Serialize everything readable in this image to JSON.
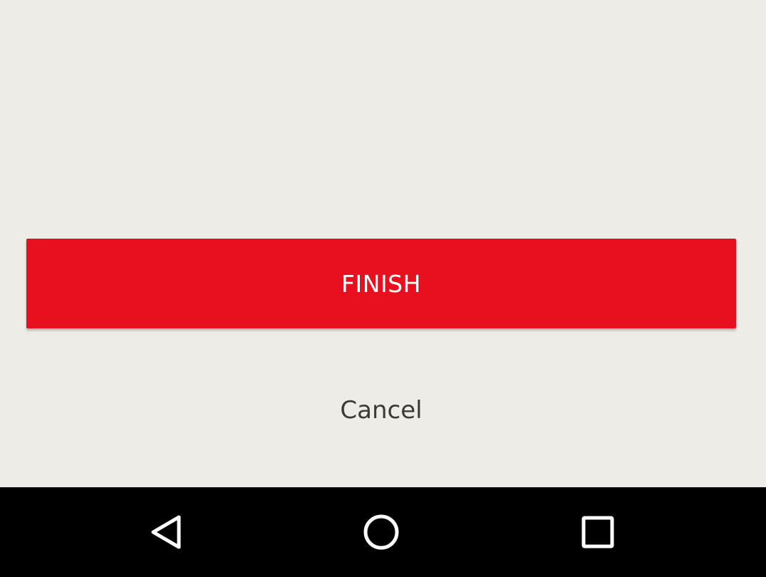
{
  "actions": {
    "finish_label": "FINISH",
    "cancel_label": "Cancel"
  },
  "navbar": {
    "items": [
      {
        "icon": "back-icon"
      },
      {
        "icon": "home-icon"
      },
      {
        "icon": "recents-icon"
      }
    ]
  },
  "colors": {
    "background": "#efebe6",
    "accent": "#e8101f",
    "text_dark": "#3a3a3a",
    "navbar": "#000000",
    "nav_icon": "#ffffff"
  }
}
